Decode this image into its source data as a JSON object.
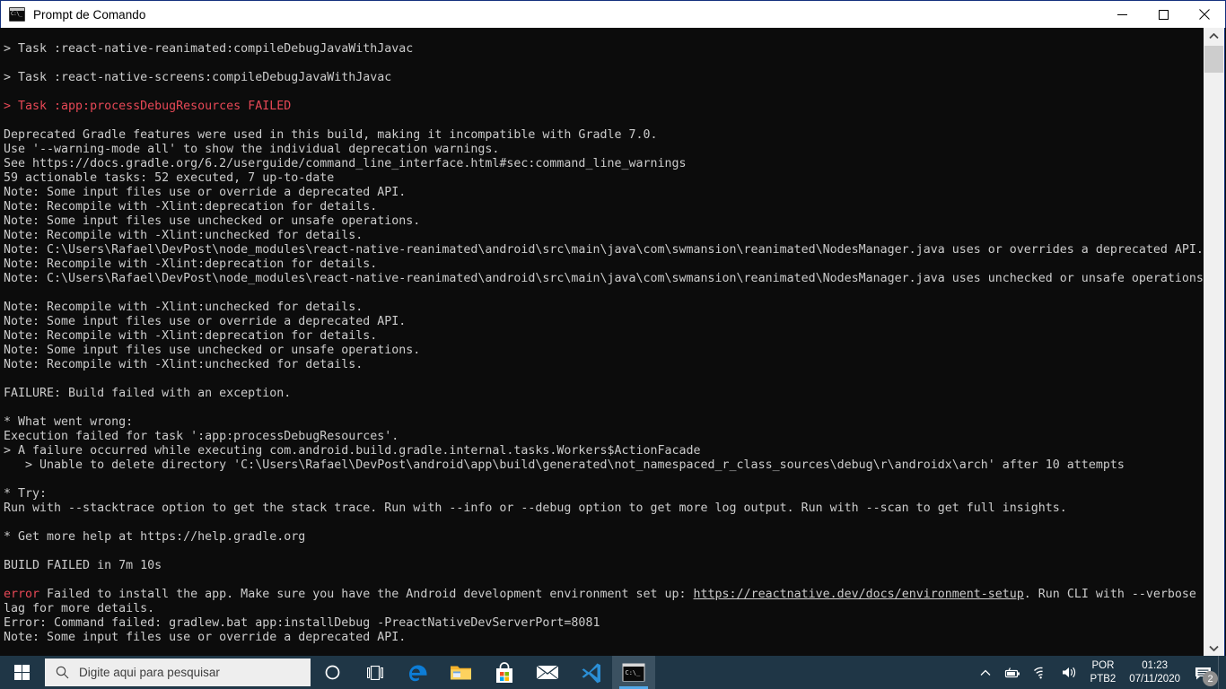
{
  "window": {
    "title": "Prompt de Comando",
    "icon": "console-icon",
    "minimize_label": "Minimizar",
    "maximize_label": "Maximizar",
    "close_label": "Fechar"
  },
  "console": {
    "lines": [
      {
        "text": "",
        "color": "grey"
      },
      {
        "text": "> Task :react-native-reanimated:compileDebugJavaWithJavac",
        "color": "grey"
      },
      {
        "text": "",
        "color": "grey"
      },
      {
        "text": "> Task :react-native-screens:compileDebugJavaWithJavac",
        "color": "grey"
      },
      {
        "text": "",
        "color": "grey"
      },
      {
        "segments": [
          {
            "text": "> Task :app:processDebugResources ",
            "color": "red"
          },
          {
            "text": "FAILED",
            "color": "red"
          }
        ]
      },
      {
        "text": "",
        "color": "grey"
      },
      {
        "text": "Deprecated Gradle features were used in this build, making it incompatible with Gradle 7.0.",
        "color": "grey"
      },
      {
        "text": "Use '--warning-mode all' to show the individual deprecation warnings.",
        "color": "grey"
      },
      {
        "text": "See https://docs.gradle.org/6.2/userguide/command_line_interface.html#sec:command_line_warnings",
        "color": "grey"
      },
      {
        "text": "59 actionable tasks: 52 executed, 7 up-to-date",
        "color": "grey"
      },
      {
        "text": "Note: Some input files use or override a deprecated API.",
        "color": "grey"
      },
      {
        "text": "Note: Recompile with -Xlint:deprecation for details.",
        "color": "grey"
      },
      {
        "text": "Note: Some input files use unchecked or unsafe operations.",
        "color": "grey"
      },
      {
        "text": "Note: Recompile with -Xlint:unchecked for details.",
        "color": "grey"
      },
      {
        "text": "Note: C:\\Users\\Rafael\\DevPost\\node_modules\\react-native-reanimated\\android\\src\\main\\java\\com\\swmansion\\reanimated\\NodesManager.java uses or overrides a deprecated API.",
        "color": "grey"
      },
      {
        "text": "Note: Recompile with -Xlint:deprecation for details.",
        "color": "grey"
      },
      {
        "text": "Note: C:\\Users\\Rafael\\DevPost\\node_modules\\react-native-reanimated\\android\\src\\main\\java\\com\\swmansion\\reanimated\\NodesManager.java uses unchecked or unsafe operations.",
        "color": "grey"
      },
      {
        "text": "",
        "color": "grey"
      },
      {
        "text": "Note: Recompile with -Xlint:unchecked for details.",
        "color": "grey"
      },
      {
        "text": "Note: Some input files use or override a deprecated API.",
        "color": "grey"
      },
      {
        "text": "Note: Recompile with -Xlint:deprecation for details.",
        "color": "grey"
      },
      {
        "text": "Note: Some input files use unchecked or unsafe operations.",
        "color": "grey"
      },
      {
        "text": "Note: Recompile with -Xlint:unchecked for details.",
        "color": "grey"
      },
      {
        "text": "",
        "color": "grey"
      },
      {
        "text": "FAILURE: Build failed with an exception.",
        "color": "grey"
      },
      {
        "text": "",
        "color": "grey"
      },
      {
        "text": "* What went wrong:",
        "color": "grey"
      },
      {
        "text": "Execution failed for task ':app:processDebugResources'.",
        "color": "grey"
      },
      {
        "text": "> A failure occurred while executing com.android.build.gradle.internal.tasks.Workers$ActionFacade",
        "color": "grey"
      },
      {
        "text": "   > Unable to delete directory 'C:\\Users\\Rafael\\DevPost\\android\\app\\build\\generated\\not_namespaced_r_class_sources\\debug\\r\\androidx\\arch' after 10 attempts",
        "color": "grey"
      },
      {
        "text": "",
        "color": "grey"
      },
      {
        "text": "* Try:",
        "color": "grey"
      },
      {
        "text": "Run with --stacktrace option to get the stack trace. Run with --info or --debug option to get more log output. Run with --scan to get full insights.",
        "color": "grey"
      },
      {
        "text": "",
        "color": "grey"
      },
      {
        "text": "* Get more help at https://help.gradle.org",
        "color": "grey"
      },
      {
        "text": "",
        "color": "grey"
      },
      {
        "text": "BUILD FAILED in 7m 10s",
        "color": "grey"
      },
      {
        "text": "",
        "color": "grey"
      },
      {
        "segments": [
          {
            "text": "error",
            "color": "red"
          },
          {
            "text": " Failed to install the app. Make sure you have the Android development environment set up: ",
            "color": "grey"
          },
          {
            "text": "https://reactnative.dev/docs/environment-setup",
            "color": "grey",
            "underline": true
          },
          {
            "text": ". Run CLI with --verbose f",
            "color": "grey"
          }
        ]
      },
      {
        "text": "lag for more details.",
        "color": "grey"
      },
      {
        "text": "Error: Command failed: gradlew.bat app:installDebug -PreactNativeDevServerPort=8081",
        "color": "grey"
      },
      {
        "text": "Note: Some input files use or override a deprecated API.",
        "color": "grey"
      }
    ]
  },
  "scrollbar": {
    "up_arrow": "scroll-up-arrow",
    "down_arrow": "scroll-down-arrow"
  },
  "taskbar": {
    "start_label": "Iniciar",
    "search": {
      "placeholder": "Digite aqui para pesquisar",
      "value": "Digite aqui para pesquisar"
    },
    "buttons": [
      {
        "name": "cortana-button",
        "icon": "circle-icon"
      },
      {
        "name": "task-view-button",
        "icon": "task-view-icon"
      },
      {
        "name": "edge-button",
        "icon": "edge-icon"
      },
      {
        "name": "file-explorer-button",
        "icon": "folder-icon"
      },
      {
        "name": "microsoft-store-button",
        "icon": "store-icon"
      },
      {
        "name": "mail-button",
        "icon": "mail-icon"
      },
      {
        "name": "vscode-button",
        "icon": "vscode-icon"
      },
      {
        "name": "command-prompt-button",
        "icon": "console-icon"
      }
    ],
    "tray": {
      "show_hidden_icons": "chevron-up-icon",
      "battery": "battery-icon",
      "network": "wifi-icon",
      "volume": "speaker-icon",
      "language_line1": "POR",
      "language_line2": "PTB2",
      "time": "01:23",
      "date": "07/11/2020",
      "notifications_count": "2"
    }
  },
  "colors": {
    "console_bg": "#0c0c0c",
    "console_fg": "#cccccc",
    "error_red": "#e74856",
    "taskbar_bg": "#1f3646",
    "window_border": "#15317e",
    "accent_blue": "#52a8e8"
  }
}
